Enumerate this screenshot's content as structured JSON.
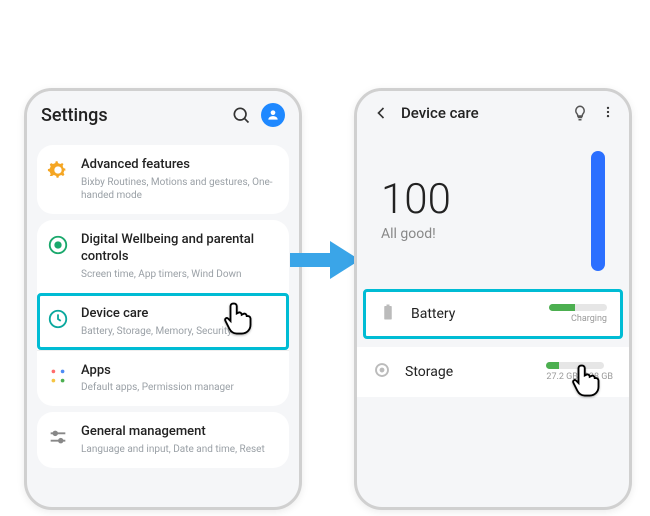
{
  "phone1": {
    "title": "Settings",
    "items": [
      {
        "title": "Advanced features",
        "sub": "Bixby Routines, Motions and gestures, One-handed mode"
      },
      {
        "title": "Digital Wellbeing and parental controls",
        "sub": "Screen time, App timers, Wind Down"
      },
      {
        "title": "Device care",
        "sub": "Battery, Storage, Memory, Security"
      },
      {
        "title": "Apps",
        "sub": "Default apps, Permission manager"
      },
      {
        "title": "General management",
        "sub": "Language and input, Date and time, Reset"
      }
    ]
  },
  "phone2": {
    "title": "Device care",
    "score": "100",
    "status": "All good!",
    "battery": {
      "label": "Battery",
      "sub": "Charging"
    },
    "storage": {
      "label": "Storage",
      "sub": "27.2 GB /128 GB"
    }
  }
}
